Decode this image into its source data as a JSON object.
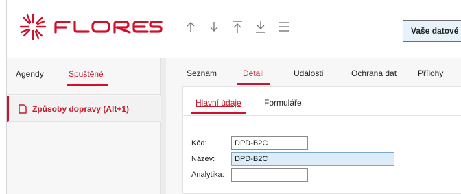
{
  "header": {
    "brand": "FLORES",
    "nav_buttons": [
      {
        "icon": "arrow-up-icon"
      },
      {
        "icon": "arrow-down-icon"
      },
      {
        "icon": "arrow-to-top-icon"
      },
      {
        "icon": "arrow-to-bottom-icon"
      },
      {
        "icon": "hamburger-menu-icon"
      }
    ],
    "data_button_label": "Vaše datové"
  },
  "left_panel": {
    "tabs": [
      {
        "label": "Agendy",
        "active": false
      },
      {
        "label": "Spuštěné",
        "active": true
      }
    ],
    "items": [
      {
        "icon": "document-icon",
        "label": "Způsoby dopravy (Alt+1)"
      }
    ]
  },
  "main": {
    "tabs": [
      {
        "label": "Seznam",
        "active": false
      },
      {
        "label": "Detail",
        "active": true
      },
      {
        "label": "Události",
        "active": false
      },
      {
        "label": "Ochrana dat",
        "active": false
      },
      {
        "label": "Přílohy",
        "active": false
      }
    ],
    "subtabs": [
      {
        "label": "Hlavní údaje",
        "active": true
      },
      {
        "label": "Formuláře",
        "active": false
      }
    ],
    "form": {
      "kod": {
        "label": "Kód:",
        "value": "DPD-B2C"
      },
      "nazev": {
        "label": "Název:",
        "value": "DPD-B2C"
      },
      "analytika": {
        "label": "Analytika:",
        "value": ""
      }
    }
  },
  "colors": {
    "accent": "#d0112b",
    "accent_text": "#c41a2a",
    "button_bg": "#e7f2fb",
    "highlight_input": "#dcedf9",
    "panel_bg": "#f7f7f7"
  }
}
